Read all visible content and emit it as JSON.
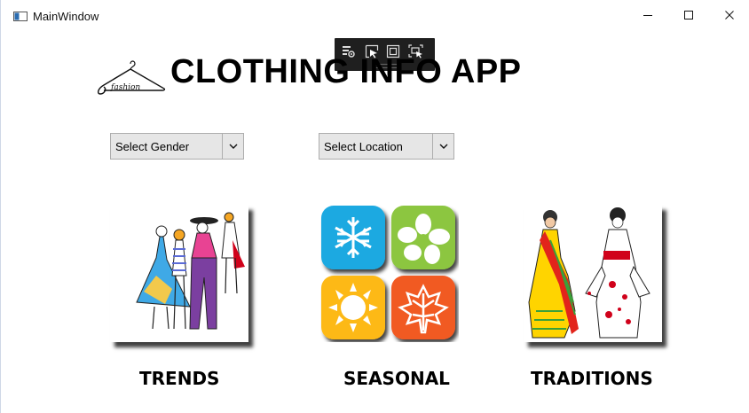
{
  "window": {
    "title": "MainWindow",
    "icon": "window-app-icon"
  },
  "debug_toolbar": {
    "tools": [
      "live-visual-tree-icon",
      "select-element-icon",
      "display-layout-adorners-icon",
      "track-focused-element-icon"
    ]
  },
  "header": {
    "logo_text": "fashion",
    "title": "CLOTHING INFO APP"
  },
  "filters": {
    "gender": {
      "selected": "Select Gender"
    },
    "location": {
      "selected": "Select Location"
    }
  },
  "categories": [
    {
      "label": "TRENDS",
      "image": "fashion-models-sketch"
    },
    {
      "label": "SEASONAL",
      "image": "four-seasons-icons"
    },
    {
      "label": "TRADITIONS",
      "image": "traditional-dress-figures"
    }
  ],
  "colors": {
    "winter": "#1aa9e1",
    "spring": "#8cc63f",
    "summer": "#fdb913",
    "autumn": "#f15a24"
  }
}
